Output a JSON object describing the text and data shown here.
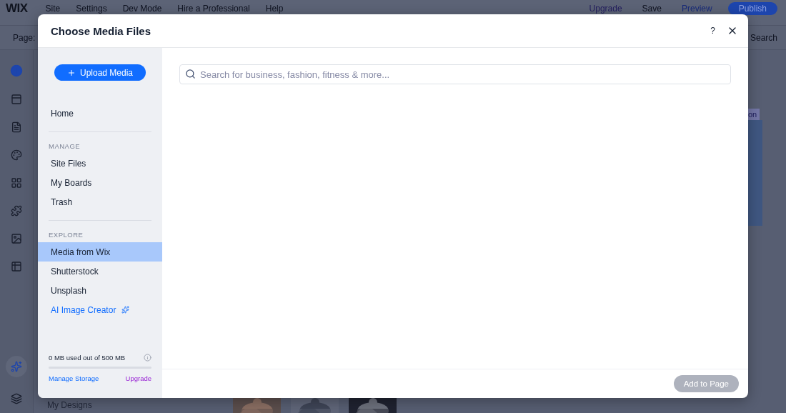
{
  "editor": {
    "logo": "WIX",
    "menu": [
      "Site",
      "Settings",
      "Dev Mode",
      "Hire a Professional",
      "Help"
    ],
    "actions": [
      {
        "label": "Upgrade",
        "kind": "upgrade"
      },
      {
        "label": "Save",
        "kind": "plain"
      },
      {
        "label": "Preview",
        "kind": "preview"
      },
      {
        "label": "Publish",
        "kind": "publish"
      }
    ],
    "page_label": "Page:",
    "search": "Search",
    "panel_item": "My Designs",
    "canvas_tab": "on"
  },
  "dialog": {
    "title": "Choose Media Files",
    "help": "?",
    "upload_button": "Upload Media",
    "nav": [
      {
        "kind": "item",
        "label": "Home",
        "selected": false
      },
      {
        "kind": "divider"
      },
      {
        "kind": "heading",
        "label": "MANAGE"
      },
      {
        "kind": "item",
        "label": "Site Files",
        "selected": false
      },
      {
        "kind": "item",
        "label": "My Boards",
        "selected": false
      },
      {
        "kind": "item",
        "label": "Trash",
        "selected": false
      },
      {
        "kind": "divider"
      },
      {
        "kind": "heading",
        "label": "EXPLORE"
      },
      {
        "kind": "item",
        "label": "Media from Wix",
        "selected": true
      },
      {
        "kind": "item",
        "label": "Shutterstock",
        "selected": false
      },
      {
        "kind": "item",
        "label": "Unsplash",
        "selected": false
      },
      {
        "kind": "link",
        "label": "AI Image Creator"
      }
    ],
    "storage": {
      "text": "0 MB used out of 500 MB",
      "level": 0,
      "manage": "Manage Storage",
      "upgrade": "Upgrade"
    },
    "search": {
      "placeholder": "Search for business, fashion, fitness & more..."
    },
    "add_button": {
      "label": "Add to Page",
      "disabled": true
    }
  }
}
